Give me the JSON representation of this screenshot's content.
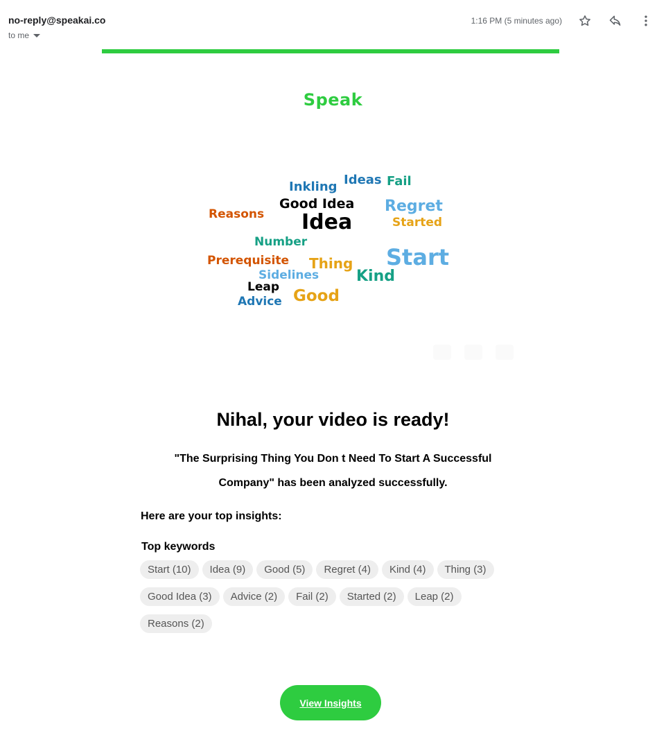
{
  "email": {
    "sender": "no-reply@speakai.co",
    "recipient_label": "to me",
    "timestamp": "1:16 PM (5 minutes ago)",
    "icons": [
      "star-icon",
      "reply-icon",
      "more-vert-icon"
    ]
  },
  "brand": {
    "logo_text": "Speak",
    "accent_color": "#2ecc40"
  },
  "word_cloud": [
    {
      "word": "Inkling",
      "color": "#1f77b4"
    },
    {
      "word": "Ideas",
      "color": "#1f77b4"
    },
    {
      "word": "Fail",
      "color": "#16a085"
    },
    {
      "word": "Good Idea",
      "color": "#000000"
    },
    {
      "word": "Regret",
      "color": "#5dade2"
    },
    {
      "word": "Reasons",
      "color": "#d35400"
    },
    {
      "word": "Idea",
      "color": "#000000"
    },
    {
      "word": "Started",
      "color": "#e6a317"
    },
    {
      "word": "Number",
      "color": "#16a085"
    },
    {
      "word": "Start",
      "color": "#5dade2"
    },
    {
      "word": "Prerequisite",
      "color": "#d35400"
    },
    {
      "word": "Thing",
      "color": "#e6a317"
    },
    {
      "word": "Sidelines",
      "color": "#5dade2"
    },
    {
      "word": "Kind",
      "color": "#16a085"
    },
    {
      "word": "Leap",
      "color": "#000000"
    },
    {
      "word": "Good",
      "color": "#e6a317"
    },
    {
      "word": "Advice",
      "color": "#1f77b4"
    }
  ],
  "content": {
    "headline": "Nihal, your video is ready!",
    "subline_1": "\"The Surprising Thing You Don t Need To Start A Successful",
    "subline_2": "Company\" has been analyzed successfully.",
    "insights_title": "Here are your top insights:",
    "keywords_title": "Top keywords"
  },
  "keywords": [
    "Start (10)",
    "Idea (9)",
    "Good (5)",
    "Regret (4)",
    "Kind (4)",
    "Thing (3)",
    "Good Idea (3)",
    "Advice (2)",
    "Fail (2)",
    "Started (2)",
    "Leap (2)",
    "Reasons (2)"
  ],
  "cta": {
    "label": "View Insights"
  }
}
